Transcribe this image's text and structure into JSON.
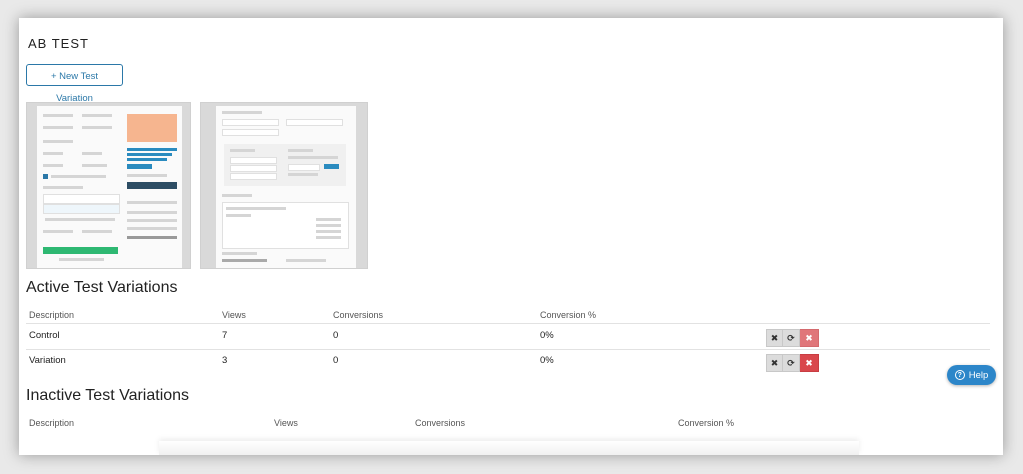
{
  "page": {
    "title": "AB TEST"
  },
  "actions": {
    "new_variation_label": "+ New Test Variation"
  },
  "active": {
    "title": "Active Test Variations",
    "columns": [
      "Description",
      "Views",
      "Conversions",
      "Conversion %"
    ],
    "rows": [
      {
        "description": "Control",
        "views": "7",
        "conversions": "0",
        "rate": "0%"
      },
      {
        "description": "Variation",
        "views": "3",
        "conversions": "0",
        "rate": "0%"
      }
    ],
    "row_action_icons": [
      "stop-icon",
      "refresh-icon",
      "delete-icon"
    ]
  },
  "inactive": {
    "title": "Inactive Test Variations",
    "columns": [
      "Description",
      "Views",
      "Conversions",
      "Conversion %"
    ]
  },
  "help": {
    "label": "Help",
    "icon": "question-circle-icon"
  },
  "colors": {
    "accent": "#2b78a8",
    "help": "#2c86c9",
    "delete": "#d9474c",
    "delete_light": "#e0767a"
  }
}
